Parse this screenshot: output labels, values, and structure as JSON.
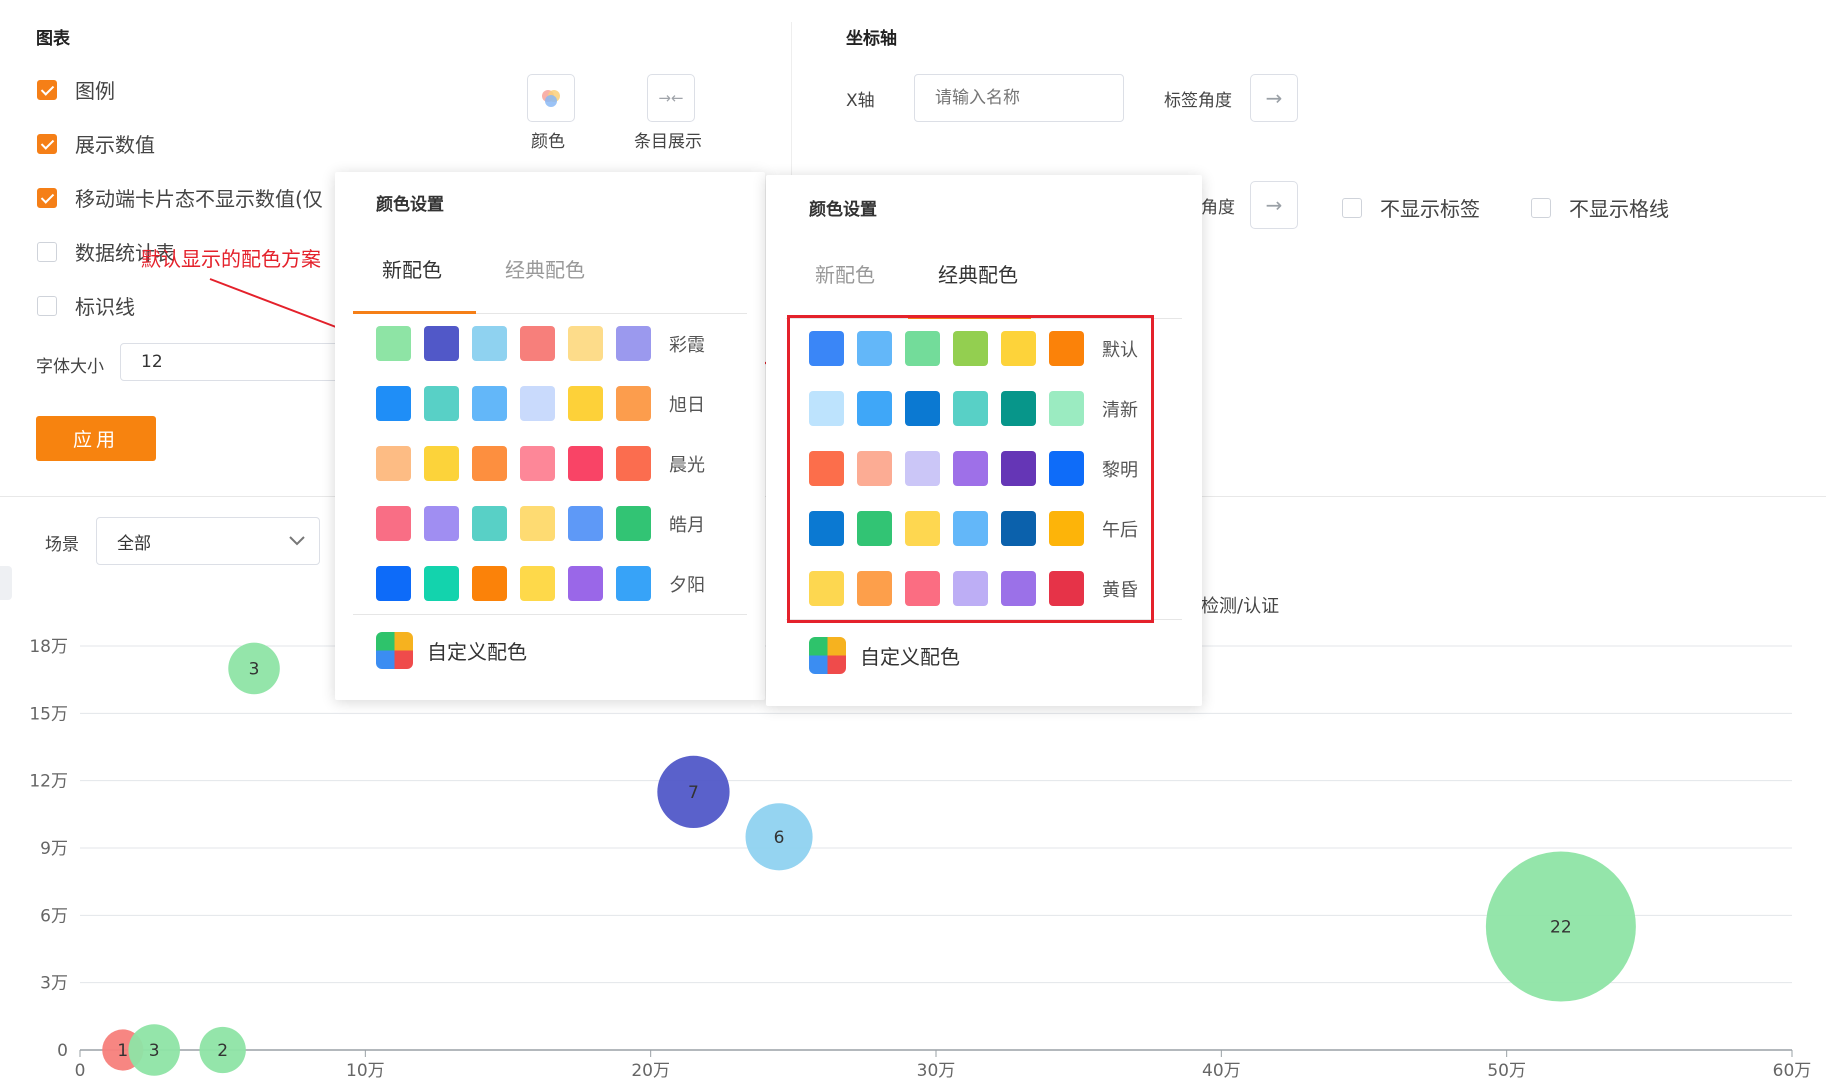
{
  "left_panel": {
    "title": "图表",
    "options": [
      {
        "label": "图例",
        "checked": true
      },
      {
        "label": "展示数值",
        "checked": true
      },
      {
        "label": "移动端卡片态不显示数值(仅",
        "checked": true
      },
      {
        "label": "数据统计表",
        "checked": false
      },
      {
        "label": "标识线",
        "checked": false
      }
    ],
    "font_size_label": "字体大小",
    "font_size_value": "12",
    "color_button_label": "颜色",
    "item_display_label": "条目展示",
    "apply_label": "应用"
  },
  "axis_panel": {
    "title": "坐标轴",
    "x_axis_label": "X轴",
    "x_axis_placeholder": "请输入名称",
    "label_angle": "标签角度",
    "label_angle_partial": "角度",
    "hide_labels": "不显示标签",
    "hide_grid": "不显示格线"
  },
  "filter": {
    "scene_label": "场景",
    "scene_value": "全部"
  },
  "legend_partial": "检测/认证",
  "annotation": "默认显示的配色方案",
  "popover_left": {
    "title": "颜色设置",
    "tabs": [
      "新配色",
      "经典配色"
    ],
    "active_tab": 0,
    "palettes": [
      {
        "name": "彩霞",
        "colors": [
          "#8ee4a5",
          "#5158c8",
          "#8fd2f0",
          "#f77f7b",
          "#fddc8a",
          "#9b99ee"
        ]
      },
      {
        "name": "旭日",
        "colors": [
          "#1f8ef7",
          "#58d0c6",
          "#63b7f9",
          "#c9dafc",
          "#fdd139",
          "#fc9d4d"
        ]
      },
      {
        "name": "晨光",
        "colors": [
          "#fdbc84",
          "#fcd33a",
          "#fd8f3f",
          "#fd8798",
          "#f94466",
          "#fb6d4f"
        ]
      },
      {
        "name": "皓月",
        "colors": [
          "#f96e85",
          "#a08ef2",
          "#58d0c6",
          "#fedb72",
          "#5e99f7",
          "#32c474"
        ]
      },
      {
        "name": "夕阳",
        "colors": [
          "#0d6bf9",
          "#13d3ad",
          "#fb8209",
          "#fed94a",
          "#9a67e8",
          "#37a3f8"
        ]
      }
    ],
    "custom_label": "自定义配色"
  },
  "popover_right": {
    "title": "颜色设置",
    "tabs": [
      "新配色",
      "经典配色"
    ],
    "active_tab": 1,
    "palettes": [
      {
        "name": "默认",
        "colors": [
          "#3a86f7",
          "#63b7f9",
          "#73dc9a",
          "#93cf50",
          "#fdd33a",
          "#fb8209"
        ]
      },
      {
        "name": "清新",
        "colors": [
          "#bde3fd",
          "#3fa7f8",
          "#0b79d2",
          "#58d0c6",
          "#07968a",
          "#9bebc1"
        ]
      },
      {
        "name": "黎明",
        "colors": [
          "#fc6e4b",
          "#fcac94",
          "#cbc6f7",
          "#9e70e8",
          "#6536b6",
          "#0e6cf9"
        ]
      },
      {
        "name": "午后",
        "colors": [
          "#0b79d2",
          "#32c474",
          "#fed750",
          "#63b7f9",
          "#0b61ac",
          "#fdb409"
        ]
      },
      {
        "name": "黄昏",
        "colors": [
          "#fdd750",
          "#fd9f4b",
          "#fb6d82",
          "#bdaef5",
          "#9b71e8",
          "#e63348"
        ]
      }
    ],
    "custom_label": "自定义配色"
  },
  "chart_data": {
    "type": "scatter",
    "x_ticks": [
      "0",
      "10万",
      "20万",
      "30万",
      "40万",
      "50万",
      "60万"
    ],
    "y_ticks": [
      "0",
      "3万",
      "6万",
      "9万",
      "12万",
      "15万",
      "18万"
    ],
    "xlim": [
      0,
      600000
    ],
    "ylim": [
      0,
      180000
    ],
    "points": [
      {
        "x": 15000,
        "y": 0,
        "size": 1,
        "label": "1",
        "color": "#f77f7b"
      },
      {
        "x": 26000,
        "y": 0,
        "size": 3,
        "label": "3",
        "color": "#8ee4a5"
      },
      {
        "x": 50000,
        "y": 0,
        "size": 2,
        "label": "2",
        "color": "#8ee4a5"
      },
      {
        "x": 61000,
        "y": 170000,
        "size": 3,
        "label": "3",
        "color": "#8ee4a5"
      },
      {
        "x": 215000,
        "y": 115000,
        "size": 7,
        "label": "7",
        "color": "#5158c8"
      },
      {
        "x": 245000,
        "y": 95000,
        "size": 6,
        "label": "6",
        "color": "#8fd2f0"
      },
      {
        "x": 519000,
        "y": 55000,
        "size": 22,
        "label": "22",
        "color": "#8ee4a5"
      }
    ]
  }
}
